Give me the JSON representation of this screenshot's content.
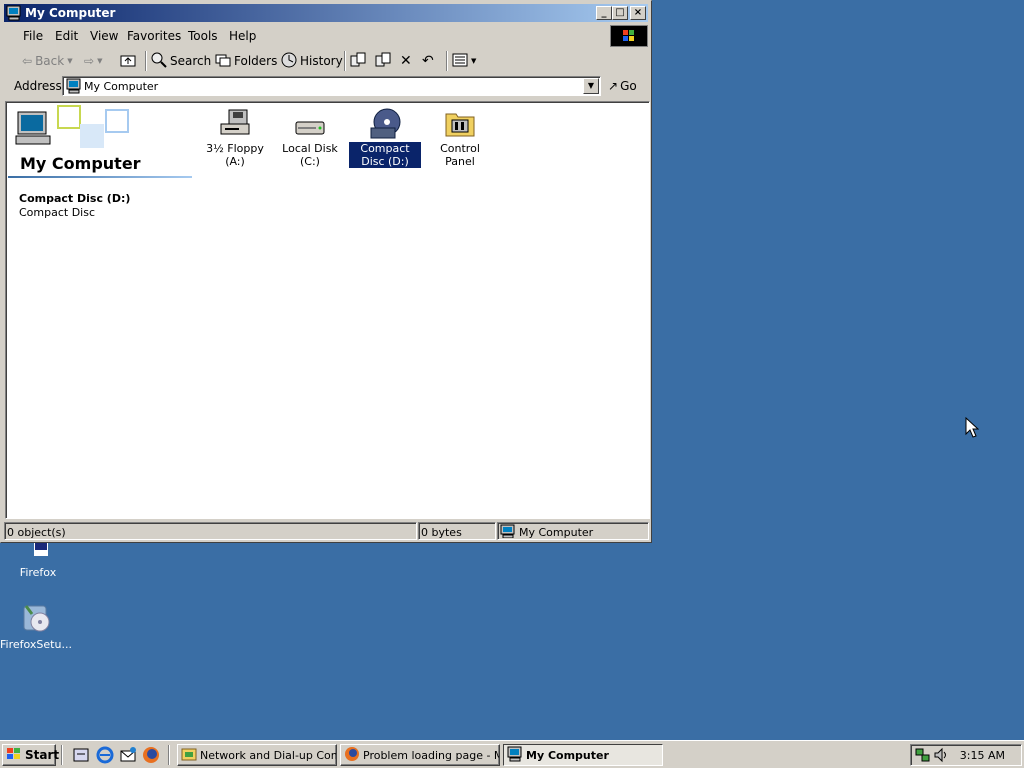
{
  "desktop": {
    "icons": [
      {
        "label": "Firefox"
      },
      {
        "label": "FirefoxSetu..."
      }
    ]
  },
  "window": {
    "title": "My Computer",
    "menu": [
      "File",
      "Edit",
      "View",
      "Favorites",
      "Tools",
      "Help"
    ],
    "toolbar": {
      "back": "Back",
      "search": "Search",
      "folders": "Folders",
      "history": "History"
    },
    "address": {
      "label": "Address",
      "value": "My Computer",
      "go": "Go"
    },
    "panel": {
      "title": "My Computer",
      "selected_name": "Compact Disc (D:)",
      "selected_type": "Compact Disc"
    },
    "items": [
      {
        "label": "3½ Floppy (A:)",
        "icon": "floppy-drive-icon"
      },
      {
        "label": "Local Disk (C:)",
        "icon": "hard-disk-icon"
      },
      {
        "label": "Compact Disc (D:)",
        "icon": "cd-drive-icon",
        "selected": true
      },
      {
        "label": "Control Panel",
        "icon": "control-panel-icon"
      }
    ],
    "status": {
      "objects": "0 object(s)",
      "size": "0 bytes",
      "zone": "My Computer"
    }
  },
  "taskbar": {
    "start": "Start",
    "tasks": [
      {
        "label": "Network and Dial-up Con..."
      },
      {
        "label": "Problem loading page - M..."
      },
      {
        "label": "My Computer",
        "active": true
      }
    ],
    "clock": "3:15 AM"
  },
  "colors": {
    "desktop": "#3a6ea5",
    "title_start": "#0a246a",
    "title_end": "#a6caf0",
    "face": "#d4d0c8"
  }
}
